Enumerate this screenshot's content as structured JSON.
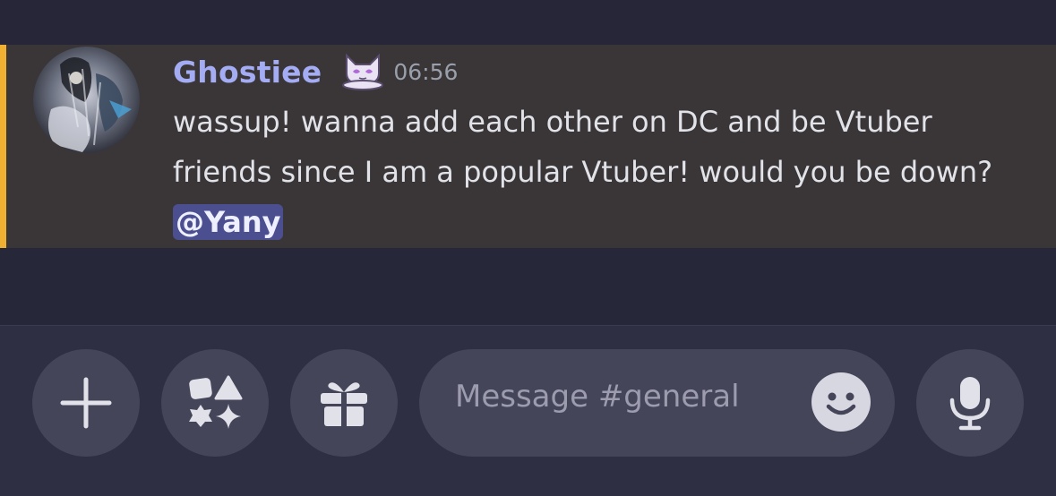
{
  "message": {
    "author": "Ghostiee",
    "timestamp": "06:56",
    "text": "wassup! wanna add each other on DC and be Vtuber friends since I am a popular Vtuber! would you be down?",
    "mention": "@Yany",
    "badge_icon": "cat-face-icon",
    "highlight_color": "#f0b132",
    "username_color": "#a4acf4"
  },
  "composer": {
    "placeholder": "Message #general",
    "buttons": [
      {
        "name": "add",
        "icon": "plus-icon"
      },
      {
        "name": "apps",
        "icon": "apps-icon"
      },
      {
        "name": "gift",
        "icon": "gift-icon"
      },
      {
        "name": "emoji",
        "icon": "smile-icon"
      },
      {
        "name": "voice",
        "icon": "microphone-icon"
      }
    ]
  }
}
